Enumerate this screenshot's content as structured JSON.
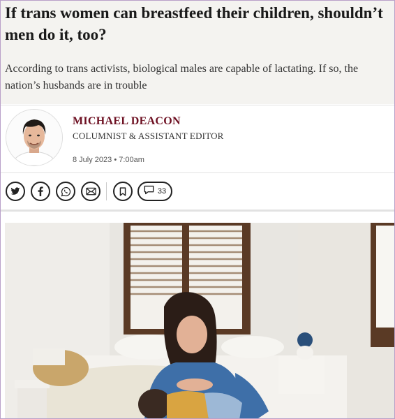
{
  "article": {
    "headline": "If trans women can breastfeed their children, shouldn’t men do it, too?",
    "standfirst": "According to trans activists, biological males are capable of lactating. If so, the nation’s husbands are in trouble"
  },
  "author": {
    "name": "MICHAEL DEACON",
    "role": "COLUMNIST & ASSISTANT EDITOR",
    "date": "8 July 2023 • 7:00am"
  },
  "share_bar": {
    "icons": [
      "twitter-icon",
      "facebook-icon",
      "whatsapp-icon",
      "email-icon",
      "bookmark-icon",
      "comment-icon"
    ],
    "comment_count": "33"
  },
  "colors": {
    "header_bg": "#f4f3f0",
    "author_name": "#6d1022",
    "border": "#b9a0c9"
  }
}
